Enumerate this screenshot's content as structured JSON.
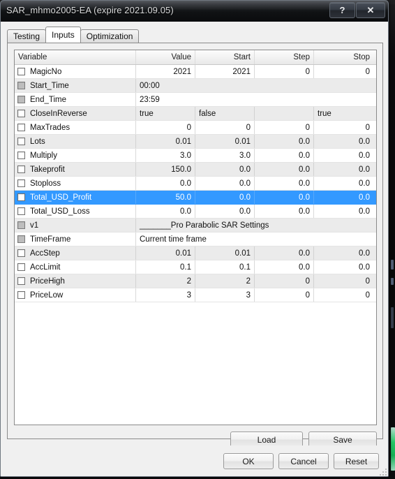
{
  "window": {
    "title": "SAR_mhmo2005-EA (expire 2021.09.05)",
    "help_button": "?",
    "close_button": "✕",
    "accent_selection": "#3399ff"
  },
  "tabs": [
    {
      "label": "Testing",
      "active": false
    },
    {
      "label": "Inputs",
      "active": true
    },
    {
      "label": "Optimization",
      "active": false
    }
  ],
  "grid": {
    "columns": [
      "Variable",
      "Value",
      "Start",
      "Step",
      "Stop"
    ],
    "rows": [
      {
        "name": "MagicNo",
        "checkbox": "unchecked",
        "kind": "num",
        "value": "2021",
        "start": "2021",
        "step": "0",
        "stop": "0",
        "selected": false
      },
      {
        "name": "Start_Time",
        "checkbox": "disabled",
        "kind": "wide",
        "value": "00:00",
        "start": "",
        "step": "",
        "stop": "",
        "selected": false
      },
      {
        "name": "End_Time",
        "checkbox": "disabled",
        "kind": "wide",
        "value": "23:59",
        "start": "",
        "step": "",
        "stop": "",
        "selected": false
      },
      {
        "name": "CloseInReverse",
        "checkbox": "unchecked",
        "kind": "text",
        "value": "true",
        "start": "false",
        "step": "",
        "stop": "true",
        "selected": false
      },
      {
        "name": "MaxTrades",
        "checkbox": "unchecked",
        "kind": "num",
        "value": "0",
        "start": "0",
        "step": "0",
        "stop": "0",
        "selected": false
      },
      {
        "name": "Lots",
        "checkbox": "unchecked",
        "kind": "num",
        "value": "0.01",
        "start": "0.01",
        "step": "0.0",
        "stop": "0.0",
        "selected": false
      },
      {
        "name": "Multiply",
        "checkbox": "unchecked",
        "kind": "num",
        "value": "3.0",
        "start": "3.0",
        "step": "0.0",
        "stop": "0.0",
        "selected": false
      },
      {
        "name": "Takeprofit",
        "checkbox": "unchecked",
        "kind": "num",
        "value": "150.0",
        "start": "0.0",
        "step": "0.0",
        "stop": "0.0",
        "selected": false
      },
      {
        "name": "Stoploss",
        "checkbox": "unchecked",
        "kind": "num",
        "value": "0.0",
        "start": "0.0",
        "step": "0.0",
        "stop": "0.0",
        "selected": false
      },
      {
        "name": "Total_USD_Profit",
        "checkbox": "unchecked",
        "kind": "num",
        "value": "50.0",
        "start": "0.0",
        "step": "0.0",
        "stop": "0.0",
        "selected": true
      },
      {
        "name": "Total_USD_Loss",
        "checkbox": "unchecked",
        "kind": "num",
        "value": "0.0",
        "start": "0.0",
        "step": "0.0",
        "stop": "0.0",
        "selected": false
      },
      {
        "name": "v1",
        "checkbox": "disabled",
        "kind": "wide",
        "value": "_______Pro Parabolic SAR Settings",
        "start": "",
        "step": "",
        "stop": "",
        "selected": false
      },
      {
        "name": "TimeFrame",
        "checkbox": "disabled",
        "kind": "wide",
        "value": "Current time frame",
        "start": "",
        "step": "",
        "stop": "",
        "selected": false
      },
      {
        "name": "AccStep",
        "checkbox": "unchecked",
        "kind": "num",
        "value": "0.01",
        "start": "0.01",
        "step": "0.0",
        "stop": "0.0",
        "selected": false
      },
      {
        "name": "AccLimit",
        "checkbox": "unchecked",
        "kind": "num",
        "value": "0.1",
        "start": "0.1",
        "step": "0.0",
        "stop": "0.0",
        "selected": false
      },
      {
        "name": "PriceHigh",
        "checkbox": "unchecked",
        "kind": "num",
        "value": "2",
        "start": "2",
        "step": "0",
        "stop": "0",
        "selected": false
      },
      {
        "name": "PriceLow",
        "checkbox": "unchecked",
        "kind": "num",
        "value": "3",
        "start": "3",
        "step": "0",
        "stop": "0",
        "selected": false
      }
    ]
  },
  "file_buttons": {
    "load": "Load",
    "save": "Save"
  },
  "dialog_buttons": {
    "ok": "OK",
    "cancel": "Cancel",
    "reset": "Reset"
  }
}
